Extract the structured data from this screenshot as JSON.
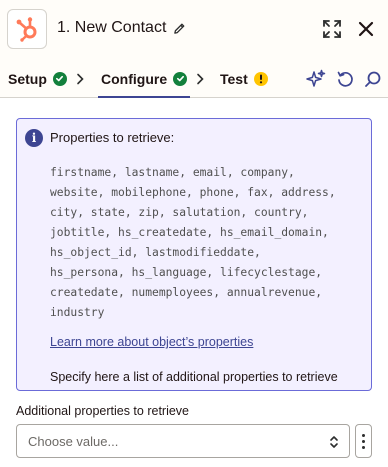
{
  "header": {
    "title": "1. New Contact",
    "app_icon": "hubspot-logo",
    "brand_color": "#ff7a59"
  },
  "tabs": [
    {
      "label": "Setup",
      "status": "complete",
      "status_color": "#13803c"
    },
    {
      "label": "Configure",
      "status": "complete",
      "status_color": "#13803c",
      "active": true
    },
    {
      "label": "Test",
      "status": "warning",
      "status_color": "#ffc400"
    }
  ],
  "toolbar_icons": [
    "ai-sparkle-icon",
    "undo-icon",
    "search-icon"
  ],
  "info_box": {
    "title": "Properties to retrieve:",
    "lines": [
      "firstname, lastname, email, company,",
      "website, mobilephone, phone, fax, address,",
      "city, state, zip, salutation, country,",
      "jobtitle, hs_createdate, hs_email_domain,",
      "hs_object_id, lastmodifieddate,",
      "hs_persona, hs_language, lifecyclestage,",
      "createdate, numemployees, annualrevenue,",
      "industry"
    ],
    "link_text": "Learn more about object’s properties",
    "footer_text": "Specify here a list of additional properties to retrieve"
  },
  "field": {
    "label": "Additional properties to retrieve",
    "placeholder": "Choose value..."
  },
  "colors": {
    "accent": "#3d4592",
    "info_bg": "#f3f0ff",
    "info_border": "#6b6bd8"
  }
}
